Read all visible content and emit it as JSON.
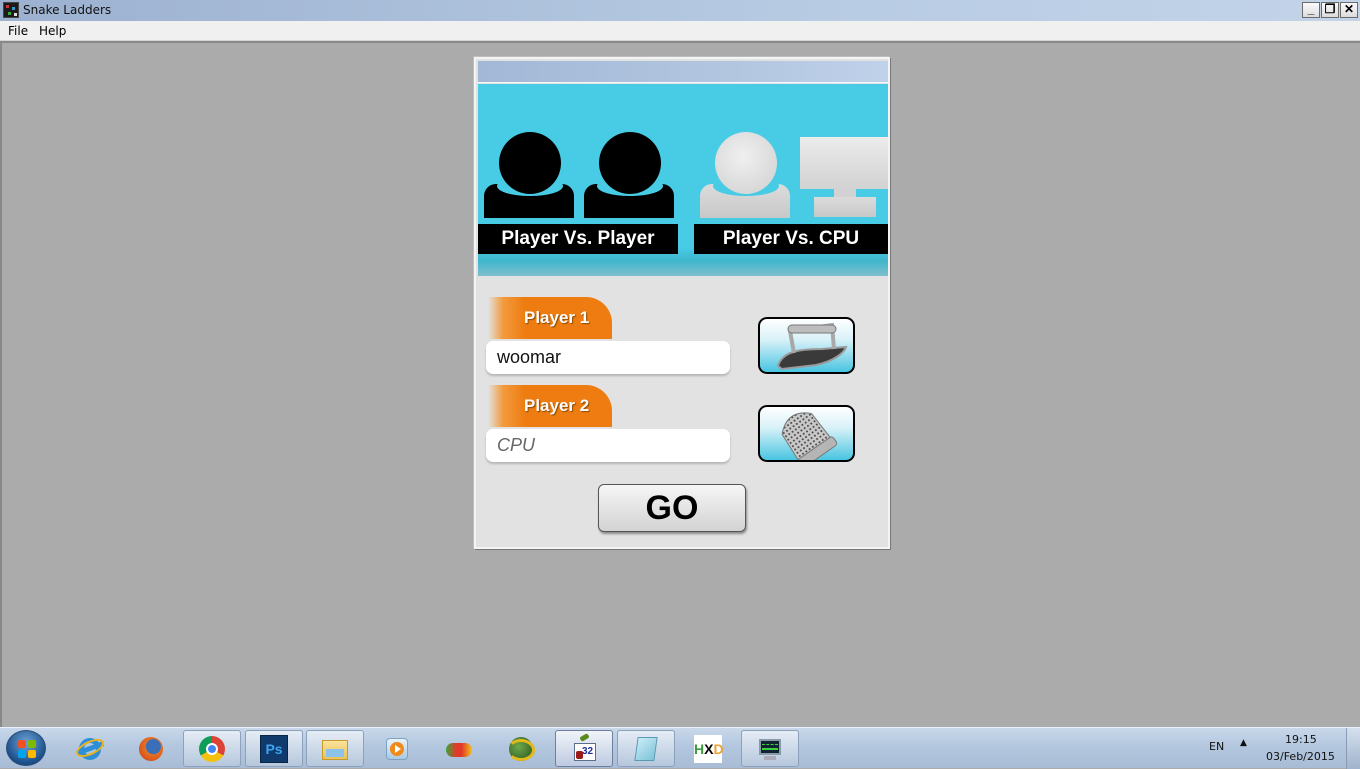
{
  "window": {
    "title": "Snake Ladders",
    "controls": {
      "minimize": "_",
      "restore": "❐",
      "close": "✕"
    }
  },
  "menu": {
    "items": [
      "File",
      "Help"
    ]
  },
  "game": {
    "modes": [
      {
        "label": "Player Vs. Player",
        "icon": "two-players-icon",
        "selected": true
      },
      {
        "label": "Player Vs. CPU",
        "icon": "player-vs-computer-icon",
        "selected": false
      }
    ],
    "players": [
      {
        "tab_label": "Player 1",
        "name_value": "woomar",
        "name_placeholder": "",
        "token": "iron-token-icon"
      },
      {
        "tab_label": "Player 2",
        "name_value": "",
        "name_placeholder": "CPU",
        "token": "thimble-token-icon"
      }
    ],
    "go_label": "GO",
    "colors": {
      "mode_bg": "#48cce6",
      "tab_orange": "#ee7c10",
      "dialog_bg": "#e2e2e2"
    }
  },
  "taskbar": {
    "start": "start-button",
    "apps": [
      {
        "name": "internet-explorer",
        "state": "pinned"
      },
      {
        "name": "firefox",
        "state": "pinned"
      },
      {
        "name": "chrome",
        "state": "open"
      },
      {
        "name": "photoshop",
        "state": "open"
      },
      {
        "name": "windows-explorer",
        "state": "open"
      },
      {
        "name": "media-player",
        "state": "pinned"
      },
      {
        "name": "visual-studio",
        "state": "pinned"
      },
      {
        "name": "globe-app",
        "state": "pinned"
      },
      {
        "name": "snake-ladders",
        "state": "active"
      },
      {
        "name": "notepad",
        "state": "open"
      },
      {
        "name": "hxd-hex-editor",
        "state": "pinned"
      },
      {
        "name": "system-monitor",
        "state": "open"
      }
    ],
    "tray": {
      "language": "EN",
      "time": "19:15",
      "date": "03/Feb/2015"
    }
  }
}
